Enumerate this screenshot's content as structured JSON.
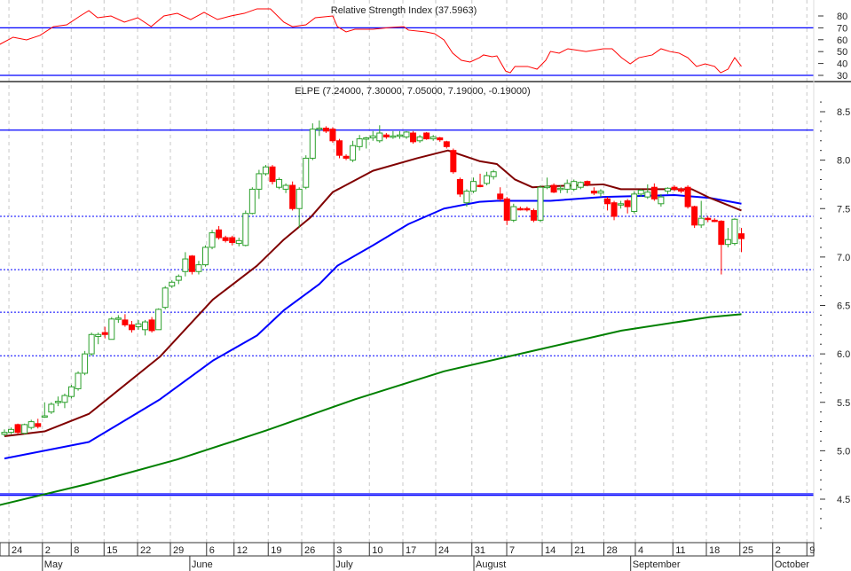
{
  "chart_data": {
    "type": "candlestick",
    "colors": {
      "up": "#2ca02c",
      "down": "#ff0000",
      "ma_short": "#800000",
      "ma_mid": "#0000ff",
      "ma_long": "#008000",
      "level": "#0000ff",
      "rsi": "#ff0000",
      "grid": "#c8c8c8"
    },
    "rsi": {
      "title": "Relative Strength Index (37.5963)",
      "ylim": [
        25,
        90
      ],
      "ticks": [
        "80",
        "70",
        "60",
        "50",
        "40",
        "30"
      ],
      "levels": [
        70,
        30
      ],
      "points": [
        [
          -0.7,
          56.1
        ],
        [
          1.3,
          62.1
        ],
        [
          3.3,
          59.9
        ],
        [
          5.3,
          63.6
        ],
        [
          7.3,
          71.0
        ],
        [
          9.3,
          72.5
        ],
        [
          11.3,
          80.0
        ],
        [
          12.6,
          84.5
        ],
        [
          13.9,
          78.5
        ],
        [
          15.9,
          80.0
        ],
        [
          17.9,
          74.8
        ],
        [
          19.9,
          78.5
        ],
        [
          21.9,
          71.0
        ],
        [
          23.8,
          80.0
        ],
        [
          25.8,
          82.2
        ],
        [
          27.8,
          77.0
        ],
        [
          29.8,
          83.0
        ],
        [
          31.8,
          77.0
        ],
        [
          33.8,
          80.0
        ],
        [
          35.8,
          82.2
        ],
        [
          37.7,
          86.0
        ],
        [
          39.7,
          86.0
        ],
        [
          41.7,
          74.8
        ],
        [
          43.0,
          71.0
        ],
        [
          45.0,
          72.5
        ],
        [
          46.4,
          78.5
        ],
        [
          49.0,
          80.0
        ],
        [
          49.7,
          71.0
        ],
        [
          51.0,
          66.6
        ],
        [
          52.3,
          68.8
        ],
        [
          55.0,
          68.8
        ],
        [
          57.6,
          70.3
        ],
        [
          59.6,
          71.0
        ],
        [
          60.3,
          68.1
        ],
        [
          62.9,
          66.6
        ],
        [
          64.2,
          65.1
        ],
        [
          65.6,
          59.9
        ],
        [
          66.9,
          48.7
        ],
        [
          68.2,
          42.7
        ],
        [
          69.5,
          41.2
        ],
        [
          70.9,
          44.9
        ],
        [
          71.5,
          47.2
        ],
        [
          72.8,
          45.7
        ],
        [
          73.5,
          46.4
        ],
        [
          74.8,
          33.7
        ],
        [
          75.5,
          32.2
        ],
        [
          76.2,
          37.5
        ],
        [
          78.1,
          37.5
        ],
        [
          79.5,
          35.2
        ],
        [
          80.8,
          42.7
        ],
        [
          81.5,
          50.1
        ],
        [
          82.8,
          48.7
        ],
        [
          84.1,
          52.4
        ],
        [
          86.8,
          50.1
        ],
        [
          89.4,
          52.4
        ],
        [
          90.7,
          52.4
        ],
        [
          92.1,
          44.9
        ],
        [
          93.4,
          39.7
        ],
        [
          94.7,
          44.9
        ],
        [
          96.7,
          47.2
        ],
        [
          98.0,
          52.4
        ],
        [
          99.3,
          50.1
        ],
        [
          100.7,
          48.7
        ],
        [
          102.0,
          44.9
        ],
        [
          103.3,
          37.5
        ],
        [
          104.6,
          39.7
        ],
        [
          106.0,
          37.5
        ],
        [
          106.9,
          32.2
        ],
        [
          108.0,
          35.2
        ],
        [
          109.0,
          44.9
        ],
        [
          110.0,
          37.6
        ]
      ]
    },
    "price": {
      "title": "ELPE (7.24000, 7.30000, 7.05000, 7.19000, -0.19000)",
      "ylim": [
        4.1,
        8.7
      ],
      "ticks": [
        "8.5",
        "8.0",
        "7.5",
        "7.0",
        "6.5",
        "6.0",
        "5.5",
        "5.0",
        "4.5"
      ],
      "levels_solid": [
        8.31,
        4.54,
        4.555
      ],
      "levels_dotted": [
        7.42,
        6.87,
        6.43,
        5.98
      ],
      "ohlc": [
        [
          5.17,
          5.22,
          5.15,
          5.19
        ],
        [
          5.19,
          5.24,
          5.17,
          5.22
        ],
        [
          5.27,
          5.28,
          5.17,
          5.19
        ],
        [
          5.18,
          5.28,
          5.17,
          5.27
        ],
        [
          5.24,
          5.32,
          5.22,
          5.3
        ],
        [
          5.28,
          5.33,
          5.23,
          5.25
        ],
        [
          5.35,
          5.5,
          5.34,
          5.36
        ],
        [
          5.4,
          5.5,
          5.38,
          5.48
        ],
        [
          5.5,
          5.56,
          5.46,
          5.51
        ],
        [
          5.5,
          5.59,
          5.44,
          5.57
        ],
        [
          5.56,
          5.68,
          5.54,
          5.66
        ],
        [
          5.64,
          5.82,
          5.62,
          5.8
        ],
        [
          5.8,
          6.03,
          5.78,
          6.0
        ],
        [
          6.0,
          6.22,
          5.98,
          6.2
        ],
        [
          6.18,
          6.22,
          6.1,
          6.2
        ],
        [
          6.22,
          6.28,
          6.16,
          6.2
        ],
        [
          6.15,
          6.38,
          6.15,
          6.36
        ],
        [
          6.37,
          6.4,
          6.32,
          6.37
        ],
        [
          6.35,
          6.41,
          6.28,
          6.3
        ],
        [
          6.3,
          6.34,
          6.22,
          6.25
        ],
        [
          6.28,
          6.35,
          6.25,
          6.31
        ],
        [
          6.25,
          6.35,
          6.19,
          6.33
        ],
        [
          6.35,
          6.38,
          6.22,
          6.24
        ],
        [
          6.25,
          6.47,
          6.25,
          6.46
        ],
        [
          6.48,
          6.7,
          6.46,
          6.68
        ],
        [
          6.7,
          6.76,
          6.68,
          6.74
        ],
        [
          6.76,
          6.82,
          6.72,
          6.8
        ],
        [
          6.85,
          7.05,
          6.8,
          6.98
        ],
        [
          7.01,
          7.02,
          6.82,
          6.85
        ],
        [
          6.85,
          6.96,
          6.82,
          6.92
        ],
        [
          6.92,
          7.12,
          6.9,
          7.1
        ],
        [
          7.1,
          7.28,
          7.08,
          7.25
        ],
        [
          7.28,
          7.32,
          7.18,
          7.2
        ],
        [
          7.2,
          7.22,
          7.15,
          7.17
        ],
        [
          7.2,
          7.22,
          7.12,
          7.15
        ],
        [
          7.14,
          7.2,
          7.11,
          7.17
        ],
        [
          7.12,
          7.48,
          7.11,
          7.45
        ],
        [
          7.45,
          7.72,
          7.44,
          7.7
        ],
        [
          7.7,
          7.9,
          7.6,
          7.86
        ],
        [
          7.86,
          7.95,
          7.84,
          7.93
        ],
        [
          7.93,
          7.95,
          7.75,
          7.78
        ],
        [
          7.72,
          7.82,
          7.7,
          7.8
        ],
        [
          7.7,
          7.76,
          7.66,
          7.74
        ],
        [
          7.74,
          7.78,
          7.48,
          7.5
        ],
        [
          7.5,
          7.72,
          7.3,
          7.7
        ],
        [
          7.72,
          8.05,
          7.7,
          8.02
        ],
        [
          8.02,
          8.38,
          8.0,
          8.32
        ],
        [
          8.32,
          8.41,
          8.25,
          8.33
        ],
        [
          8.33,
          8.35,
          8.28,
          8.3
        ],
        [
          8.32,
          8.34,
          8.18,
          8.2
        ],
        [
          8.2,
          8.22,
          8.02,
          8.05
        ],
        [
          8.04,
          8.06,
          8.0,
          8.02
        ],
        [
          8.0,
          8.2,
          7.98,
          8.15
        ],
        [
          8.14,
          8.26,
          8.1,
          8.22
        ],
        [
          8.22,
          8.24,
          8.12,
          8.23
        ],
        [
          8.23,
          8.3,
          8.2,
          8.25
        ],
        [
          8.2,
          8.36,
          8.18,
          8.28
        ],
        [
          8.26,
          8.28,
          8.22,
          8.24
        ],
        [
          8.24,
          8.3,
          8.22,
          8.25
        ],
        [
          8.25,
          8.3,
          8.22,
          8.26
        ],
        [
          8.24,
          8.3,
          8.22,
          8.29
        ],
        [
          8.28,
          8.3,
          8.17,
          8.19
        ],
        [
          8.2,
          8.26,
          8.18,
          8.24
        ],
        [
          8.28,
          8.29,
          8.21,
          8.22
        ],
        [
          8.22,
          8.26,
          8.2,
          8.24
        ],
        [
          8.23,
          8.24,
          8.19,
          8.21
        ],
        [
          8.19,
          8.2,
          8.12,
          8.14
        ],
        [
          8.1,
          8.12,
          7.86,
          7.88
        ],
        [
          7.8,
          7.82,
          7.62,
          7.65
        ],
        [
          7.56,
          7.7,
          7.52,
          7.68
        ],
        [
          7.68,
          7.82,
          7.66,
          7.78
        ],
        [
          7.74,
          7.86,
          7.72,
          7.73
        ],
        [
          7.76,
          7.88,
          7.74,
          7.84
        ],
        [
          7.83,
          7.9,
          7.8,
          7.88
        ],
        [
          7.65,
          7.72,
          7.58,
          7.6
        ],
        [
          7.6,
          7.62,
          7.33,
          7.38
        ],
        [
          7.38,
          7.55,
          7.36,
          7.52
        ],
        [
          7.5,
          7.52,
          7.48,
          7.49
        ],
        [
          7.5,
          7.52,
          7.47,
          7.49
        ],
        [
          7.48,
          7.5,
          7.36,
          7.38
        ],
        [
          7.38,
          7.74,
          7.36,
          7.72
        ],
        [
          7.72,
          7.82,
          7.7,
          7.73
        ],
        [
          7.74,
          7.76,
          7.66,
          7.67
        ],
        [
          7.7,
          7.74,
          7.66,
          7.71
        ],
        [
          7.7,
          7.8,
          7.66,
          7.76
        ],
        [
          7.7,
          7.8,
          7.68,
          7.78
        ],
        [
          7.72,
          7.78,
          7.7,
          7.77
        ],
        [
          7.78,
          7.79,
          7.73,
          7.75
        ],
        [
          7.68,
          7.72,
          7.64,
          7.66
        ],
        [
          7.66,
          7.7,
          7.62,
          7.68
        ],
        [
          7.6,
          7.62,
          7.48,
          7.55
        ],
        [
          7.56,
          7.58,
          7.38,
          7.42
        ],
        [
          7.54,
          7.58,
          7.5,
          7.55
        ],
        [
          7.58,
          7.6,
          7.45,
          7.52
        ],
        [
          7.47,
          7.68,
          7.45,
          7.65
        ],
        [
          7.65,
          7.7,
          7.62,
          7.69
        ],
        [
          7.62,
          7.75,
          7.6,
          7.67
        ],
        [
          7.72,
          7.76,
          7.58,
          7.6
        ],
        [
          7.55,
          7.65,
          7.52,
          7.62
        ],
        [
          7.68,
          7.72,
          7.65,
          7.71
        ],
        [
          7.72,
          7.74,
          7.68,
          7.7
        ],
        [
          7.7,
          7.72,
          7.66,
          7.68
        ],
        [
          7.72,
          7.74,
          7.5,
          7.52
        ],
        [
          7.52,
          7.53,
          7.3,
          7.33
        ],
        [
          7.33,
          7.58,
          7.3,
          7.4
        ],
        [
          7.4,
          7.42,
          7.36,
          7.39
        ],
        [
          7.38,
          7.4,
          7.36,
          7.37
        ],
        [
          7.37,
          7.38,
          6.82,
          7.13
        ],
        [
          7.13,
          7.3,
          7.1,
          7.18
        ],
        [
          7.14,
          7.4,
          7.12,
          7.39
        ],
        [
          7.24,
          7.3,
          7.05,
          7.19
        ]
      ],
      "ma_short": [
        [
          0,
          5.15
        ],
        [
          6,
          5.2
        ],
        [
          12.6,
          5.38
        ],
        [
          23.2,
          5.97
        ],
        [
          31.1,
          6.56
        ],
        [
          37.7,
          6.91
        ],
        [
          41.7,
          7.18
        ],
        [
          45.7,
          7.41
        ],
        [
          49,
          7.67
        ],
        [
          55,
          7.89
        ],
        [
          61.6,
          8.02
        ],
        [
          66.2,
          8.1
        ],
        [
          70.9,
          7.99
        ],
        [
          73.5,
          7.96
        ],
        [
          76.2,
          7.8
        ],
        [
          78.8,
          7.72
        ],
        [
          81.5,
          7.73
        ],
        [
          89.4,
          7.75
        ],
        [
          92,
          7.7
        ],
        [
          100,
          7.7
        ],
        [
          102.6,
          7.7
        ],
        [
          105.3,
          7.61
        ],
        [
          110,
          7.48
        ]
      ],
      "ma_mid": [
        [
          0,
          4.92
        ],
        [
          12.6,
          5.09
        ],
        [
          23.2,
          5.53
        ],
        [
          31.1,
          5.93
        ],
        [
          37.7,
          6.19
        ],
        [
          41.7,
          6.45
        ],
        [
          47,
          6.72
        ],
        [
          49.7,
          6.91
        ],
        [
          55,
          7.12
        ],
        [
          60.3,
          7.34
        ],
        [
          65.6,
          7.5
        ],
        [
          70.9,
          7.57
        ],
        [
          73.5,
          7.58
        ],
        [
          78.8,
          7.58
        ],
        [
          81.5,
          7.58
        ],
        [
          89.4,
          7.62
        ],
        [
          100,
          7.64
        ],
        [
          105.3,
          7.61
        ],
        [
          110,
          7.55
        ]
      ],
      "ma_long": [
        [
          -0.7,
          4.44
        ],
        [
          12.6,
          4.66
        ],
        [
          25.8,
          4.91
        ],
        [
          39.1,
          5.21
        ],
        [
          52.3,
          5.53
        ],
        [
          65.6,
          5.82
        ],
        [
          78.8,
          6.03
        ],
        [
          92.1,
          6.24
        ],
        [
          105.3,
          6.38
        ],
        [
          110,
          6.41
        ]
      ]
    },
    "x_axis": {
      "day_ticks": [
        [
          1.2,
          "24"
        ],
        [
          6.2,
          "2"
        ],
        [
          10.5,
          "8"
        ],
        [
          15.4,
          "15"
        ],
        [
          20.4,
          "22"
        ],
        [
          25.3,
          "29"
        ],
        [
          30.7,
          "6"
        ],
        [
          34.8,
          "12"
        ],
        [
          39.9,
          "19"
        ],
        [
          44.9,
          "26"
        ],
        [
          49.7,
          "3"
        ],
        [
          55,
          "10"
        ],
        [
          60,
          "17"
        ],
        [
          64.9,
          "24"
        ],
        [
          70.3,
          "31"
        ],
        [
          75.5,
          "7"
        ],
        [
          80.8,
          "14"
        ],
        [
          85.2,
          "21"
        ],
        [
          90,
          "28"
        ],
        [
          94.7,
          "4"
        ],
        [
          100.3,
          "11"
        ],
        [
          105.3,
          "18"
        ],
        [
          110.3,
          "25"
        ],
        [
          115.2,
          "2"
        ],
        [
          120.3,
          "9"
        ]
      ],
      "months": [
        [
          6.2,
          "May"
        ],
        [
          28.2,
          "June"
        ],
        [
          49.7,
          "July"
        ],
        [
          70.6,
          "August"
        ],
        [
          94.0,
          "September"
        ],
        [
          115.2,
          "October"
        ]
      ]
    }
  }
}
